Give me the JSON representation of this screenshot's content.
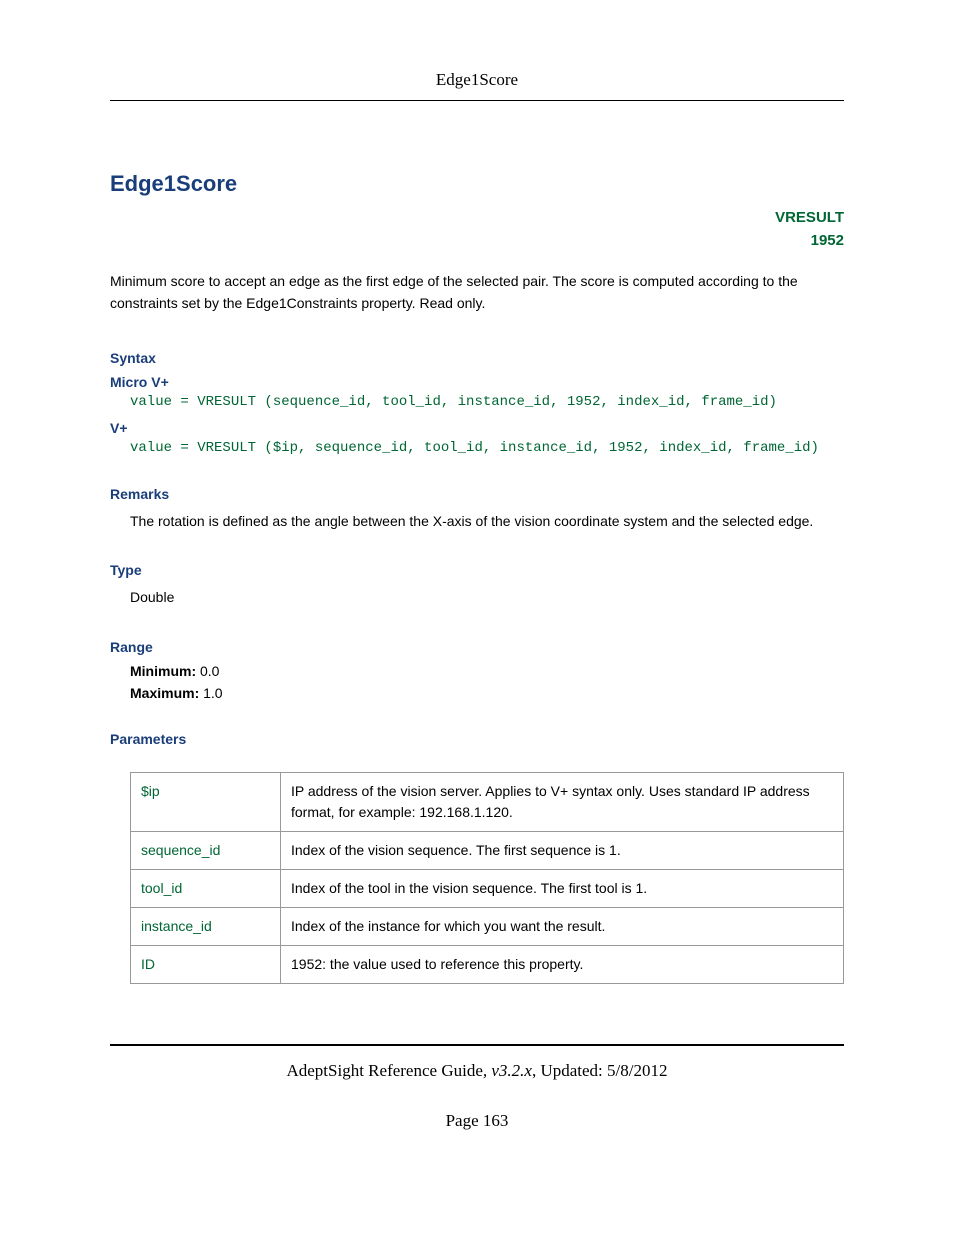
{
  "header": {
    "runningTitle": "Edge1Score"
  },
  "title": "Edge1Score",
  "meta": {
    "vresult": "VRESULT",
    "code": "1952"
  },
  "description": "Minimum score to accept an edge as the first edge of the selected pair. The score is computed according to the constraints set by the Edge1Constraints property. Read only.",
  "syntax": {
    "heading": "Syntax",
    "microLabel": "Micro V+",
    "microCode": "value = VRESULT (sequence_id, tool_id, instance_id, 1952, index_id, frame_id)",
    "vplusLabel": "V+",
    "vplusCode": "value = VRESULT ($ip, sequence_id, tool_id, instance_id, 1952, index_id, frame_id)"
  },
  "remarks": {
    "heading": "Remarks",
    "text": "The rotation is defined as the angle between the X-axis of the vision coordinate system and the selected edge."
  },
  "type": {
    "heading": "Type",
    "value": "Double"
  },
  "range": {
    "heading": "Range",
    "minLabel": "Minimum:",
    "minValue": "0.0",
    "maxLabel": "Maximum:",
    "maxValue": "1.0"
  },
  "parameters": {
    "heading": "Parameters",
    "rows": [
      {
        "name": "$ip",
        "desc": "IP address of the vision server. Applies to V+ syntax only. Uses standard IP address format, for example: 192.168.1.120."
      },
      {
        "name": "sequence_id",
        "desc": "Index of the vision sequence. The first sequence is 1."
      },
      {
        "name": "tool_id",
        "desc": "Index of the tool in the vision sequence. The first tool is 1."
      },
      {
        "name": "instance_id",
        "desc": "Index of the instance for which you want the result."
      },
      {
        "name": "ID",
        "desc": "1952: the value used to reference this property."
      }
    ]
  },
  "footer": {
    "guide": "AdeptSight Reference Guide",
    "version": "v3.2.x",
    "updatedLabel": "Updated:",
    "updatedDate": "5/8/2012",
    "pageLabel": "Page",
    "pageNumber": "163"
  }
}
